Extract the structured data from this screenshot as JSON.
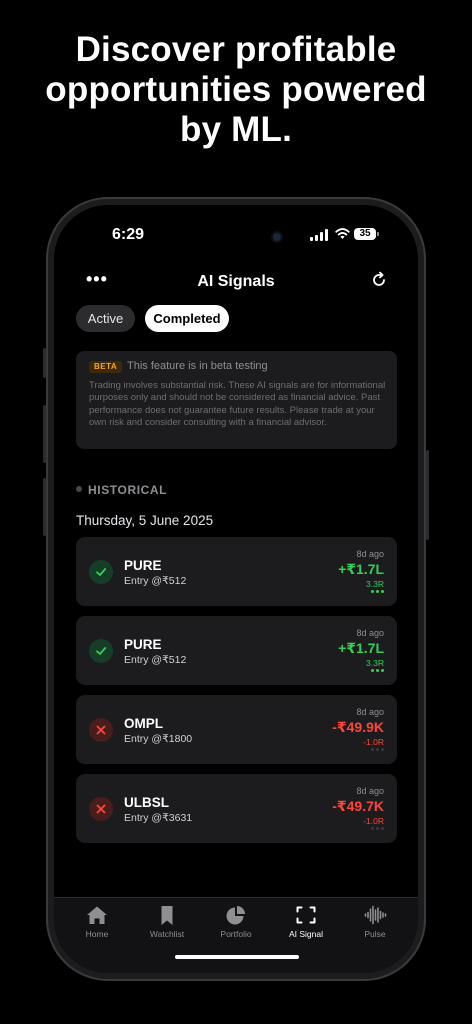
{
  "headline": {
    "line1": "Discover profitable",
    "line2": "opportunities powered",
    "line3": "by ML."
  },
  "status_bar": {
    "time": "6:29",
    "battery": "35"
  },
  "nav": {
    "more_label": "•••",
    "title": "AI Signals"
  },
  "tabs": {
    "active_label": "Active",
    "completed_label": "Completed",
    "selected": "Completed"
  },
  "notice": {
    "badge": "BETA",
    "heading": "This feature is in beta testing",
    "body": "Trading involves substantial risk. These AI signals are for informational purposes only and should not be considered as financial advice. Past performance does not guarantee future results. Please trade at your own risk and consider consulting with a financial advisor."
  },
  "section": {
    "label": "HISTORICAL",
    "date": "Thursday, 5 June 2025"
  },
  "signals": [
    {
      "symbol": "PURE",
      "entry": "Entry @₹512",
      "ago": "8d ago",
      "pnl": "+₹1.7L",
      "r": "3.3R",
      "outcome": "win"
    },
    {
      "symbol": "PURE",
      "entry": "Entry @₹512",
      "ago": "8d ago",
      "pnl": "+₹1.7L",
      "r": "3.3R",
      "outcome": "win"
    },
    {
      "symbol": "OMPL",
      "entry": "Entry @₹1800",
      "ago": "8d ago",
      "pnl": "-₹49.9K",
      "r": "-1.0R",
      "outcome": "loss"
    },
    {
      "symbol": "ULBSL",
      "entry": "Entry @₹3631",
      "ago": "8d ago",
      "pnl": "-₹49.7K",
      "r": "-1.0R",
      "outcome": "loss"
    }
  ],
  "tabbar": {
    "items": [
      {
        "label": "Home",
        "icon": "home-icon"
      },
      {
        "label": "Watchlist",
        "icon": "bookmark-icon"
      },
      {
        "label": "Portfolio",
        "icon": "pie-chart-icon"
      },
      {
        "label": "AI Signal",
        "icon": "scan-icon"
      },
      {
        "label": "Pulse",
        "icon": "waveform-icon"
      }
    ],
    "selected": "AI Signal"
  },
  "colors": {
    "profit": "#30d158",
    "loss": "#ff453a",
    "beta": "#f5a623",
    "card": "#1c1c1e"
  }
}
